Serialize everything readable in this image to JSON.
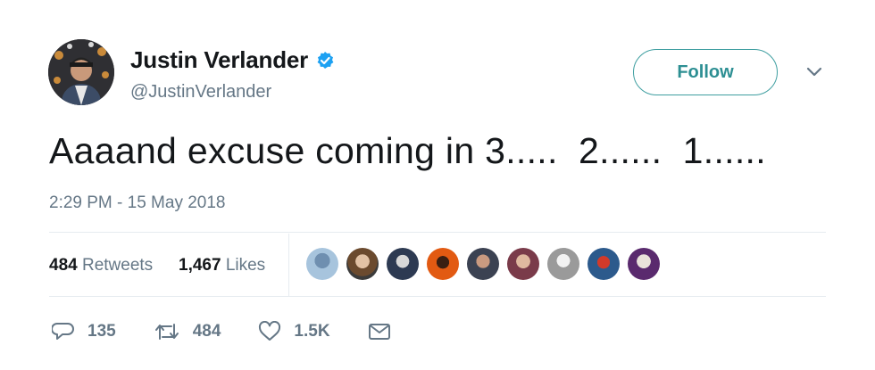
{
  "author": {
    "name": "Justin Verlander",
    "handle": "@JustinVerlander",
    "verified": true
  },
  "follow_label": "Follow",
  "tweet": {
    "text": "Aaaand excuse coming in 3.....  2......  1......",
    "timestamp": "2:29 PM - 15 May 2018"
  },
  "stats": {
    "retweets_count": "484",
    "retweets_label": "Retweets",
    "likes_count": "1,467",
    "likes_label": "Likes"
  },
  "likers": [
    "avatar-1",
    "avatar-2",
    "avatar-3",
    "avatar-4",
    "avatar-5",
    "avatar-6",
    "avatar-7",
    "avatar-8",
    "avatar-9"
  ],
  "actions": {
    "replies": "135",
    "retweets": "484",
    "likes": "1.5K"
  },
  "colors": {
    "text": "#14171a",
    "secondary": "#657786",
    "follow_accent": "#2d8f93",
    "verified_blue": "#1da1f2",
    "divider": "#e6ecf0"
  },
  "icons": [
    "verified-badge-icon",
    "chevron-down-icon",
    "reply-icon",
    "retweet-icon",
    "like-icon",
    "direct-message-icon"
  ]
}
